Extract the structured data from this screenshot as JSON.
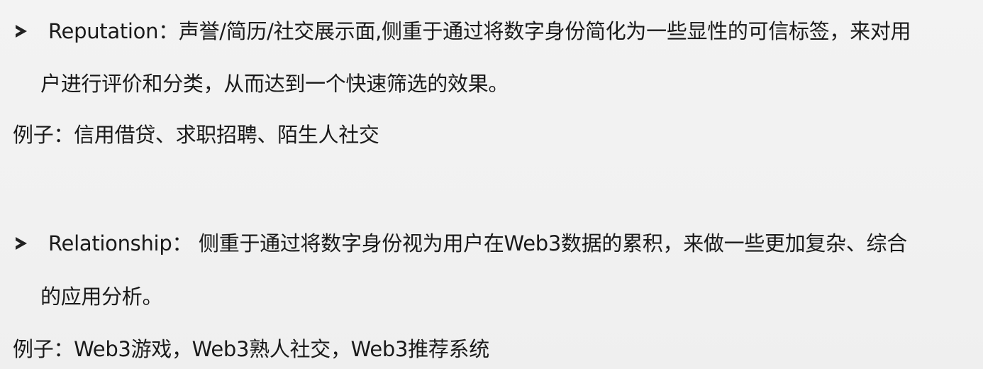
{
  "section_reputation": {
    "bullet_icon": "arrow-bullet-icon",
    "line1": "Reputation：声誉/简历/社交展示面,侧重于通过将数字身份简化为一些显性的可信标签，来对用",
    "line2": "户进行评价和分类，从而达到一个快速筛选的效果。",
    "example": "例子：信用借贷、求职招聘、陌生人社交"
  },
  "section_relationship": {
    "bullet_icon": "arrow-bullet-icon",
    "line1": "Relationship： 侧重于通过将数字身份视为用户在Web3数据的累积，来做一些更加复杂、综合",
    "line2": "的应用分析。",
    "example": "例子：Web3游戏，Web3熟人社交，Web3推荐系统"
  }
}
